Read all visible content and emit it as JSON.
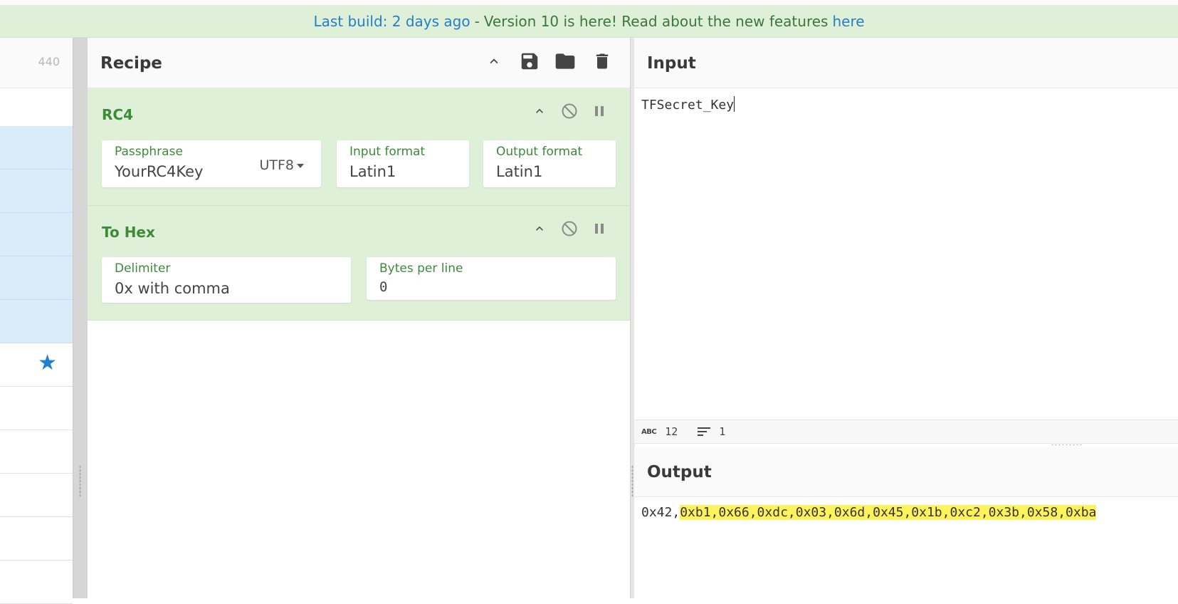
{
  "banner": {
    "prefix": "Last build: 2 days ago",
    "separator": "-",
    "message": "Version 10 is here! Read about the new features",
    "link": "here"
  },
  "operations": {
    "count": "440"
  },
  "recipe": {
    "title": "Recipe",
    "ops": [
      {
        "name": "RC4",
        "args": [
          {
            "label": "Passphrase",
            "value": "YourRC4Key",
            "dropdown": "UTF8"
          },
          {
            "label": "Input format",
            "value": "Latin1"
          },
          {
            "label": "Output format",
            "value": "Latin1"
          }
        ]
      },
      {
        "name": "To Hex",
        "args": [
          {
            "label": "Delimiter",
            "value": "0x with comma"
          },
          {
            "label": "Bytes per line",
            "value": "0"
          }
        ]
      }
    ]
  },
  "input": {
    "title": "Input",
    "text": "TFSecret_Key",
    "status": {
      "abc_label": "ABC",
      "length": "12",
      "lines": "1"
    }
  },
  "output": {
    "title": "Output",
    "prefix": "0x42,",
    "highlighted": "0xb1,0x66,0xdc,0x03,0x6d,0x45,0x1b,0xc2,0x3b,0x58,0xba"
  },
  "colors": {
    "banner_bg": "#dff0d8",
    "op_bg": "#dff0d8",
    "op_title": "#3c8a3a",
    "link": "#2a7cc7",
    "selected_row": "#d9ecf7",
    "star": "#1e7fd6",
    "highlight": "#fff35c"
  },
  "icons": [
    "chevron-up-icon",
    "save-icon",
    "folder-icon",
    "trash-icon",
    "disable-icon",
    "pause-icon",
    "star-icon",
    "lines-icon"
  ]
}
